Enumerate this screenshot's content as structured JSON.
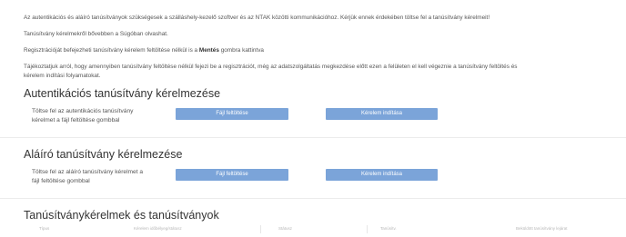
{
  "intro": {
    "line1": "Az autentikációs és aláíró tanúsítványok szükségesek a szálláshely-kezelő szoftver és az NTAK közötti kommunikációhoz. Kérjük ennek érdekében töltse fel a tanúsítvány kérelmeit!",
    "line2": "Tanúsítvány kérelmekről bővebben a Súgóban olvashat.",
    "line3_before": "Regisztrációját befejezheti tanúsítvány kérelem feltöltése nélkül is a ",
    "line3_bold": "Mentés",
    "line3_after": " gombra kattintva",
    "line4a": "Tájékoztatjuk arról, hogy amennyiben tanúsítvány feltöltése nélkül fejezi be a regisztrációt, még az adatszolgáltatás megkezdése előtt ezen a felületen el kell végeznie a tanúsítvány feltöltés és",
    "line4b": "kérelem indítási folyamatokat."
  },
  "auth_section": {
    "title": "Autentikációs tanúsítvány kérelmezése",
    "desc_line1": "Töltse fel az autentikációs tanúsítvány",
    "desc_line2": "kérelmet a fájl feltöltése gombbal",
    "upload_label": "Fájl feltöltése",
    "start_label": "Kérelem indítása"
  },
  "sign_section": {
    "title": "Aláíró tanúsítvány kérelmezése",
    "desc_line1": "Töltse fel az aláíró tanúsítvány kérelmet a",
    "desc_line2": "fájl feltöltése gombbal",
    "upload_label": "Fájl feltöltése",
    "start_label": "Kérelem indítása"
  },
  "table_section": {
    "title": "Tanúsítványkérelmek és tanúsítványok",
    "columns": [
      "Típus",
      "Kérelem időbélyeg/státusz",
      "Státusz",
      "Tanúsítv.",
      "Beküldött tanúsítvány lejárat"
    ]
  },
  "colors": {
    "button_bg": "#7ba4d9",
    "button_text": "#ffffff",
    "divider": "#ececec"
  }
}
